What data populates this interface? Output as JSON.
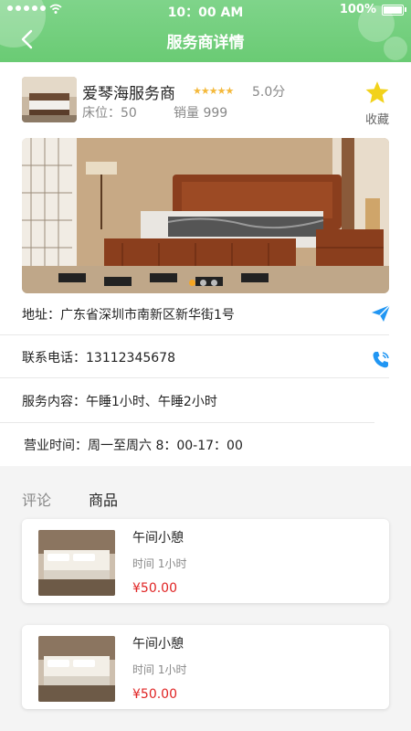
{
  "status_bar": {
    "time": "10：00 AM",
    "battery": "100%"
  },
  "header": {
    "title": "服务商详情"
  },
  "provider": {
    "name": "爱琴海服务商",
    "rating_stars": 5,
    "score": "5.0分",
    "beds": "床位：50",
    "sales": "销量 999",
    "favorite_label": "收藏"
  },
  "banner": {
    "slides": 3,
    "active_slide": 1
  },
  "info": {
    "address": "地址：广东省深圳市南新区新华街1号",
    "phone": "联系电话：13112345678",
    "service": "服务内容：午睡1小时、午睡2小时",
    "hours": "营业时间：周一至周六 8：00-17：00"
  },
  "tabs": [
    {
      "label": "评论",
      "active": false
    },
    {
      "label": "商品",
      "active": true
    }
  ],
  "products": [
    {
      "name": "午间小憩",
      "duration": "时间 1小时",
      "price": "¥50.00"
    },
    {
      "name": "午间小憩",
      "duration": "时间 1小时",
      "price": "¥50.00"
    }
  ],
  "colors": {
    "header": "#6acb74",
    "price": "#e02424",
    "star": "#f4b93b",
    "icon_blue": "#2196f3"
  }
}
